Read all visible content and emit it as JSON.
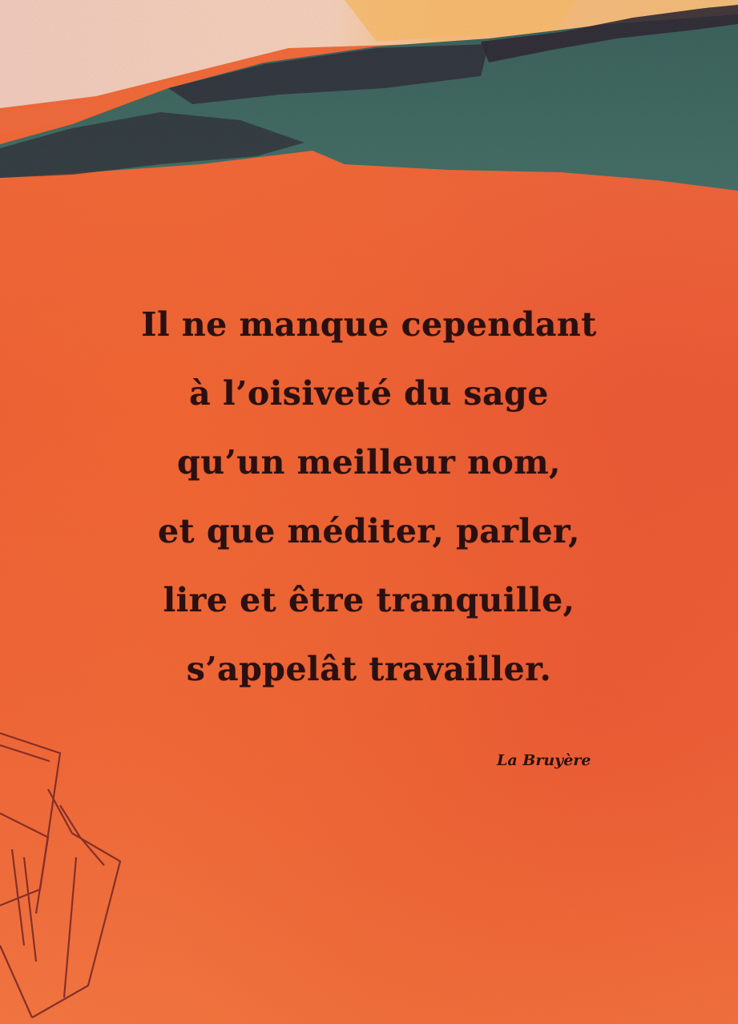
{
  "quote": {
    "lines": [
      "Il ne manque cependant",
      "à l’oisiveté du sage",
      "qu’un meilleur nom,",
      "et que méditer, parler,",
      "lire et être tranquille,",
      "s’appelât travailler."
    ],
    "author": "La Bruyère"
  },
  "colors": {
    "background": "#ec5a36",
    "teal_band": "#2f6a66",
    "dark_stroke": "#1f2333",
    "sky": "#f2d9c8",
    "text": "#2a1010"
  }
}
